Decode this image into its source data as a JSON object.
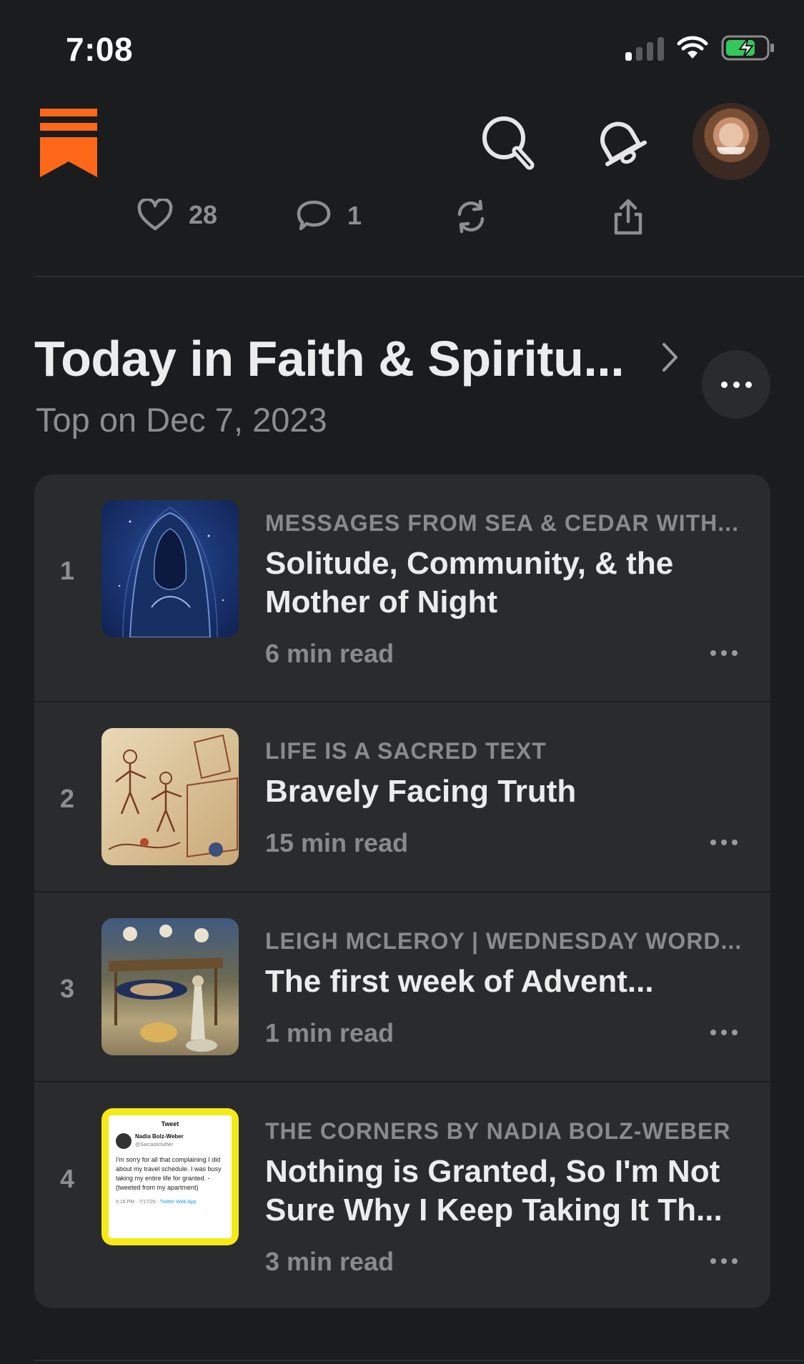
{
  "status_bar": {
    "time": "7:08"
  },
  "header": {
    "brand": "Substack",
    "search_icon": "search-icon",
    "notifications_icon": "bell-icon",
    "avatar_alt": "Profile"
  },
  "actions": {
    "likes": "28",
    "comments": "1",
    "restack_icon": "restack-icon",
    "share_icon": "share-icon"
  },
  "section": {
    "title": "Today in Faith & Spiritu...",
    "subtitle": "Top on Dec 7, 2023"
  },
  "posts": [
    {
      "rank": "1",
      "publication": "MESSAGES FROM SEA & CEDAR WITH...",
      "title": "Solitude, Community, & the Mother of Night",
      "meta": "6 min read"
    },
    {
      "rank": "2",
      "publication": "LIFE IS A SACRED TEXT",
      "title": "Bravely Facing Truth",
      "meta": "15 min read"
    },
    {
      "rank": "3",
      "publication": "LEIGH MCLEROY | WEDNESDAY WORD...",
      "title": "The first week of Advent...",
      "meta": "1 min read"
    },
    {
      "rank": "4",
      "publication": "THE CORNERS BY NADIA BOLZ-WEBER",
      "title": "Nothing is Granted, So I'm Not Sure Why I Keep Taking It Th...",
      "meta": "3 min read",
      "thumb_tweet": {
        "header": "Tweet",
        "name": "Nadia Bolz-Weber",
        "handle": "@Sarcasticluther",
        "body": "I'm sorry for all that complaining I did about my travel schedule. I was busy taking my entire life for granted. -(tweeted from my apartment)",
        "time": "5:16 PM · 7/17/20 ·",
        "app": "Twitter Web App"
      }
    }
  ],
  "colors": {
    "background": "#1b1c1e",
    "card": "#2a2b2d",
    "brand_orange": "#ff6719",
    "battery_green": "#34c759"
  }
}
